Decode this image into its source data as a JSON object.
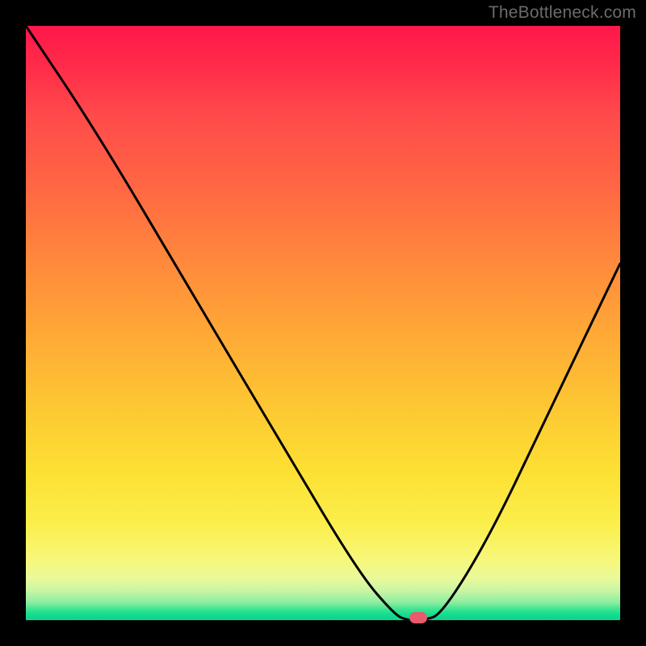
{
  "watermark": "TheBottleneck.com",
  "chart_data": {
    "type": "line",
    "title": "",
    "xlabel": "",
    "ylabel": "",
    "xlim": [
      0,
      100
    ],
    "ylim": [
      0,
      100
    ],
    "grid": false,
    "legend": false,
    "series": [
      {
        "name": "bottleneck-curve",
        "x": [
          0,
          12,
          28,
          44,
          56,
          62,
          64,
          67,
          70,
          78,
          88,
          100
        ],
        "y": [
          100,
          82,
          55,
          28,
          8,
          1,
          0,
          0,
          1,
          14,
          35,
          60
        ]
      }
    ],
    "marker": {
      "x": 66,
      "y": 0,
      "color": "#e85a6d"
    },
    "background": {
      "type": "vertical-gradient",
      "stops": [
        {
          "pos": 0,
          "color": "#ff1749"
        },
        {
          "pos": 50,
          "color": "#ffa936"
        },
        {
          "pos": 85,
          "color": "#fbef4c"
        },
        {
          "pos": 100,
          "color": "#0fd28c"
        }
      ]
    }
  }
}
